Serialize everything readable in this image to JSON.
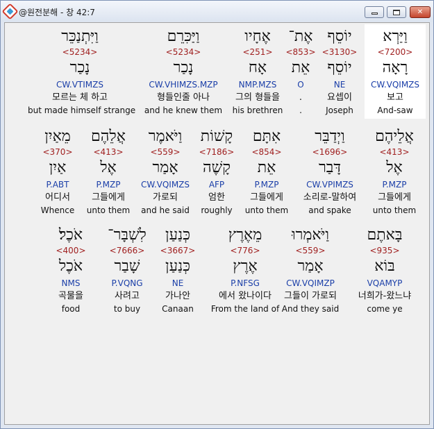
{
  "window": {
    "title": "@원전분해 - 창 42:7",
    "min_label": "",
    "max_label": "",
    "close_label": "✕"
  },
  "rows": [
    {
      "words": [
        {
          "heb": "וַיַּרְא",
          "strong": "<7200>",
          "lemma": "רָאָה",
          "morph": "CW.VQIMZS",
          "ko": "보고",
          "en": "And-saw",
          "selected": true
        },
        {
          "heb": "יוֹסֵף",
          "strong": "<3130>",
          "lemma": "יוֹסֵף",
          "morph": "NE",
          "ko": "요셉이",
          "en": "Joseph",
          "selected": false
        },
        {
          "heb": "אֶת־",
          "strong": "<853>",
          "lemma": "אֵת",
          "morph": "O",
          "ko": ".",
          "en": ".",
          "selected": false
        },
        {
          "heb": "אֶחָיו",
          "strong": "<251>",
          "lemma": "אָח",
          "morph": "NMP.MZS",
          "ko": "그의 형들을",
          "en": "his brethren",
          "selected": false
        },
        {
          "heb": "וַיַּכִּרֵם",
          "strong": "<5234>",
          "lemma": "נָכַר",
          "morph": "CW.VHIMZS.MZP",
          "ko": "형들인줄 아나",
          "en": "and he knew them",
          "selected": false
        },
        {
          "heb": "וַיִּתְנַכֵּר",
          "strong": "<5234>",
          "lemma": "נָכַר",
          "morph": "CW.VTIMZS",
          "ko": "모르는 체 하고",
          "en": "but made himself strange",
          "selected": false
        }
      ]
    },
    {
      "words": [
        {
          "heb": "אֲלֵיהֶם",
          "strong": "<413>",
          "lemma": "אֶל",
          "morph": "P.MZP",
          "ko": "그들에게",
          "en": "unto them",
          "selected": false
        },
        {
          "heb": "וַיְדַבֵּר",
          "strong": "<1696>",
          "lemma": "דָּבַר",
          "morph": "CW.VPIMZS",
          "ko": "소리로-말하여",
          "en": "and spake",
          "selected": false
        },
        {
          "heb": "אִתָּם",
          "strong": "<854>",
          "lemma": "אֵת",
          "morph": "P.MZP",
          "ko": "그들에게",
          "en": "unto them",
          "selected": false
        },
        {
          "heb": "קָשׁוֹת",
          "strong": "<7186>",
          "lemma": "קָשֶׁה",
          "morph": "AFP",
          "ko": "엄한",
          "en": "roughly",
          "selected": false
        },
        {
          "heb": "וַיֹּאמֶר",
          "strong": "<559>",
          "lemma": "אָמַר",
          "morph": "CW.VQIMZS",
          "ko": "가로되",
          "en": "and he said",
          "selected": false
        },
        {
          "heb": "אֲלֵהֶם",
          "strong": "<413>",
          "lemma": "אֶל",
          "morph": "P.MZP",
          "ko": "그들에게",
          "en": "unto them",
          "selected": false
        },
        {
          "heb": "מֵאַיִן",
          "strong": "<370>",
          "lemma": "אַיִן",
          "morph": "P.ABT",
          "ko": "어디서",
          "en": "Whence",
          "selected": false
        }
      ]
    },
    {
      "words": [
        {
          "heb": "בָּאתֶם",
          "strong": "<935>",
          "lemma": "בּוֹא",
          "morph": "VQAMYP",
          "ko": "너희가-왔느냐",
          "en": "come ye",
          "selected": false
        },
        {
          "heb": "וַיֹּאמְרוּ",
          "strong": "<559>",
          "lemma": "אָמַר",
          "morph": "CW.VQIMZP",
          "ko": "그들이 가로되",
          "en": "And they said",
          "selected": false
        },
        {
          "heb": "מֵאֶרֶץ",
          "strong": "<776>",
          "lemma": "אֶרֶץ",
          "morph": "P.NFSG",
          "ko": "에서 왔나이다",
          "en": "From the land of",
          "selected": false
        },
        {
          "heb": "כְּנַעַן",
          "strong": "<3667>",
          "lemma": "כְּנַעַן",
          "morph": "NE",
          "ko": "가나안",
          "en": "Canaan",
          "selected": false
        },
        {
          "heb": "לִשְׁבָּר־",
          "strong": "<7666>",
          "lemma": "שָׁבַר",
          "morph": "P.VQNG",
          "ko": "사려고",
          "en": "to buy",
          "selected": false
        },
        {
          "heb": "אֹכֶל׃",
          "strong": "<400>",
          "lemma": "אֹכֶל",
          "morph": "NMS",
          "ko": "곡물을",
          "en": "food",
          "selected": false
        }
      ]
    }
  ]
}
